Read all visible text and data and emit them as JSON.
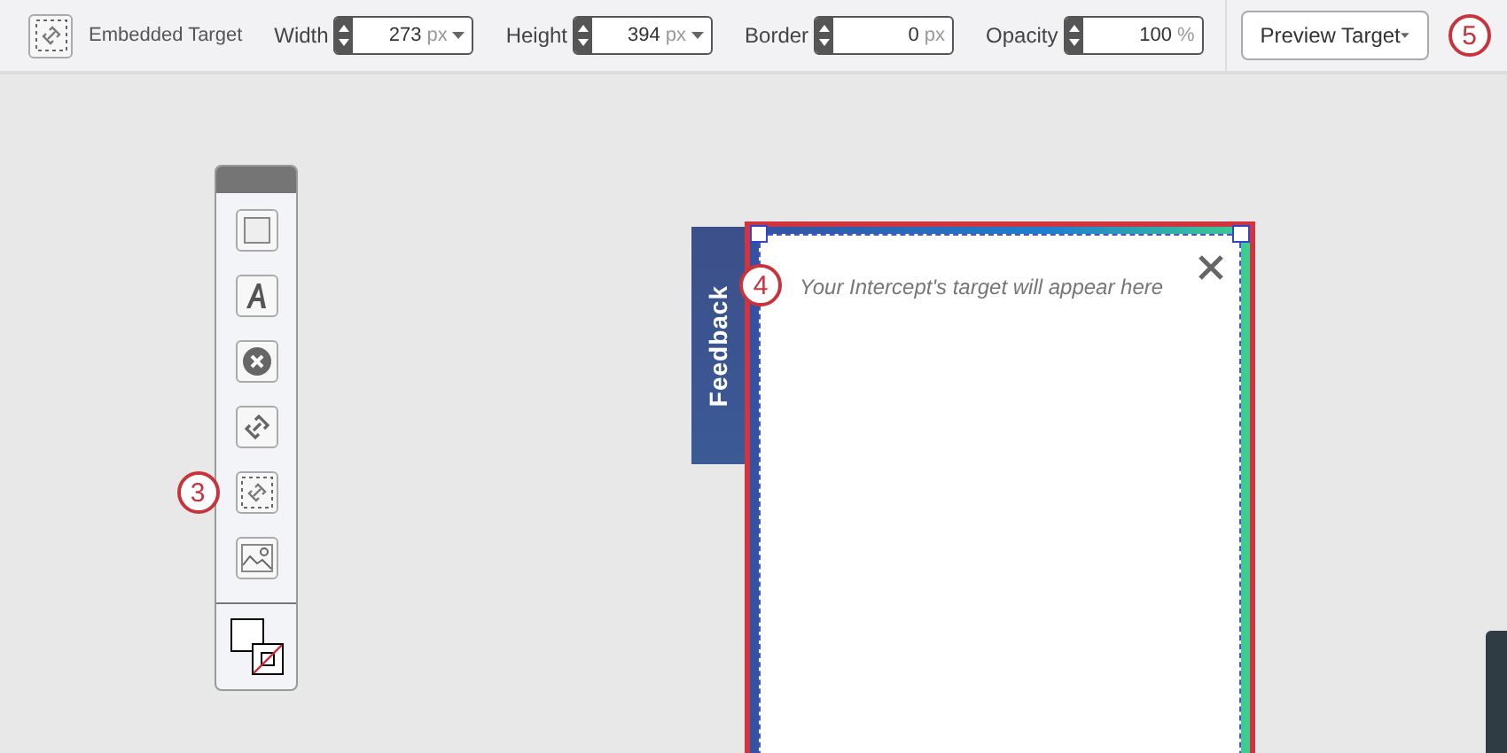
{
  "toolbar": {
    "element_label": "Embedded Target",
    "fields": [
      {
        "label": "Width",
        "value": "273",
        "unit": "px",
        "unit_menu": true
      },
      {
        "label": "Height",
        "value": "394",
        "unit": "px",
        "unit_menu": true
      },
      {
        "label": "Border",
        "value": "0",
        "unit": "px",
        "unit_menu": false
      },
      {
        "label": "Opacity",
        "value": "100",
        "unit": "%",
        "unit_menu": false
      }
    ],
    "preview_button": "Preview Target",
    "callout": "5"
  },
  "palette": {
    "tools": [
      {
        "kind": "rectangle"
      },
      {
        "kind": "text"
      },
      {
        "kind": "close"
      },
      {
        "kind": "link"
      },
      {
        "kind": "embedded-target",
        "callout": "3"
      },
      {
        "kind": "image"
      }
    ]
  },
  "feedback_tab": {
    "label": "Feedback"
  },
  "target": {
    "message": "Your Intercept's target will appear here",
    "callout": "4"
  }
}
